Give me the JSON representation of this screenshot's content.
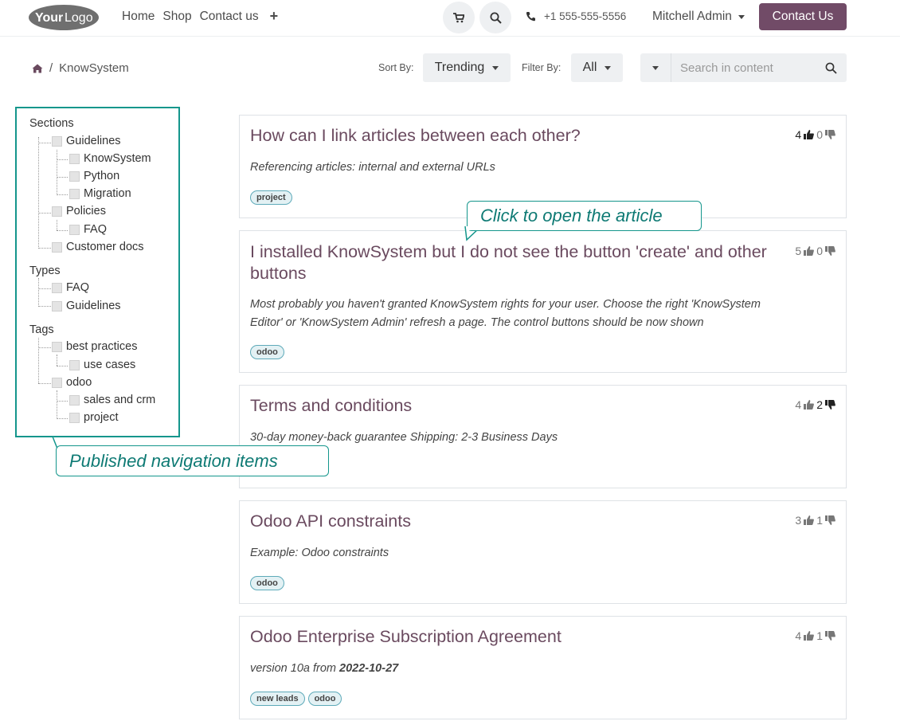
{
  "header": {
    "logo_text_a": "Your",
    "logo_text_b": "Logo",
    "nav": [
      "Home",
      "Shop",
      "Contact us"
    ],
    "plus_label": "+",
    "phone": "+1 555-555-5556",
    "user": "Mitchell Admin",
    "contact_button": "Contact Us"
  },
  "toolbar": {
    "breadcrumb_current": "KnowSystem",
    "breadcrumb_sep": "/",
    "sort_label": "Sort By:",
    "sort_value": "Trending",
    "filter_label": "Filter By:",
    "filter_value": "All",
    "search_placeholder": "Search in content"
  },
  "sidebar": {
    "sections_title": "Sections",
    "sections": [
      "Guidelines",
      "KnowSystem",
      "Python",
      "Migration",
      "Policies",
      "FAQ",
      "Customer docs"
    ],
    "types_title": "Types",
    "types": [
      "FAQ",
      "Guidelines"
    ],
    "tags_title": "Tags",
    "tags": [
      "best practices",
      "use cases",
      "odoo",
      "sales and crm",
      "project"
    ]
  },
  "articles": [
    {
      "title": "How can I link articles between each other?",
      "desc": "Referencing articles: internal and external URLs",
      "likes": "4",
      "dislikes": "0",
      "tags": [
        "project"
      ]
    },
    {
      "title_1": "I installed KnowSystem but I do not see the button 'create' and other",
      "title_2": "buttons",
      "desc_1": "Most probably you haven't granted KnowSystem rights for your user. Choose the right 'KnowSystem",
      "desc_2": "Editor' or 'KnowSystem Admin' refresh a page. The control buttons should be now shown",
      "likes": "5",
      "dislikes": "0",
      "tags": [
        "odoo"
      ]
    },
    {
      "title": "Terms and conditions",
      "desc": "30-day money-back guarantee Shipping: 2-3 Business Days",
      "likes": "4",
      "dislikes": "2",
      "tags": []
    },
    {
      "title": "Odoo API constraints",
      "desc": "Example: Odoo constraints",
      "likes": "3",
      "dislikes": "1",
      "tags": [
        "odoo"
      ]
    },
    {
      "title": "Odoo Enterprise Subscription Agreement",
      "desc_plain": "version 10a from ",
      "desc_bold": "2022-10-27",
      "likes": "4",
      "dislikes": "1",
      "tags": [
        "new leads",
        "odoo"
      ]
    }
  ],
  "callouts": {
    "open_article": "Click to open the article",
    "navigation": "Published navigation items"
  },
  "colors": {
    "brand": "#714b67",
    "title": "#6a4a5f",
    "callout": "#14968c",
    "tag_border": "#5eaab9"
  }
}
